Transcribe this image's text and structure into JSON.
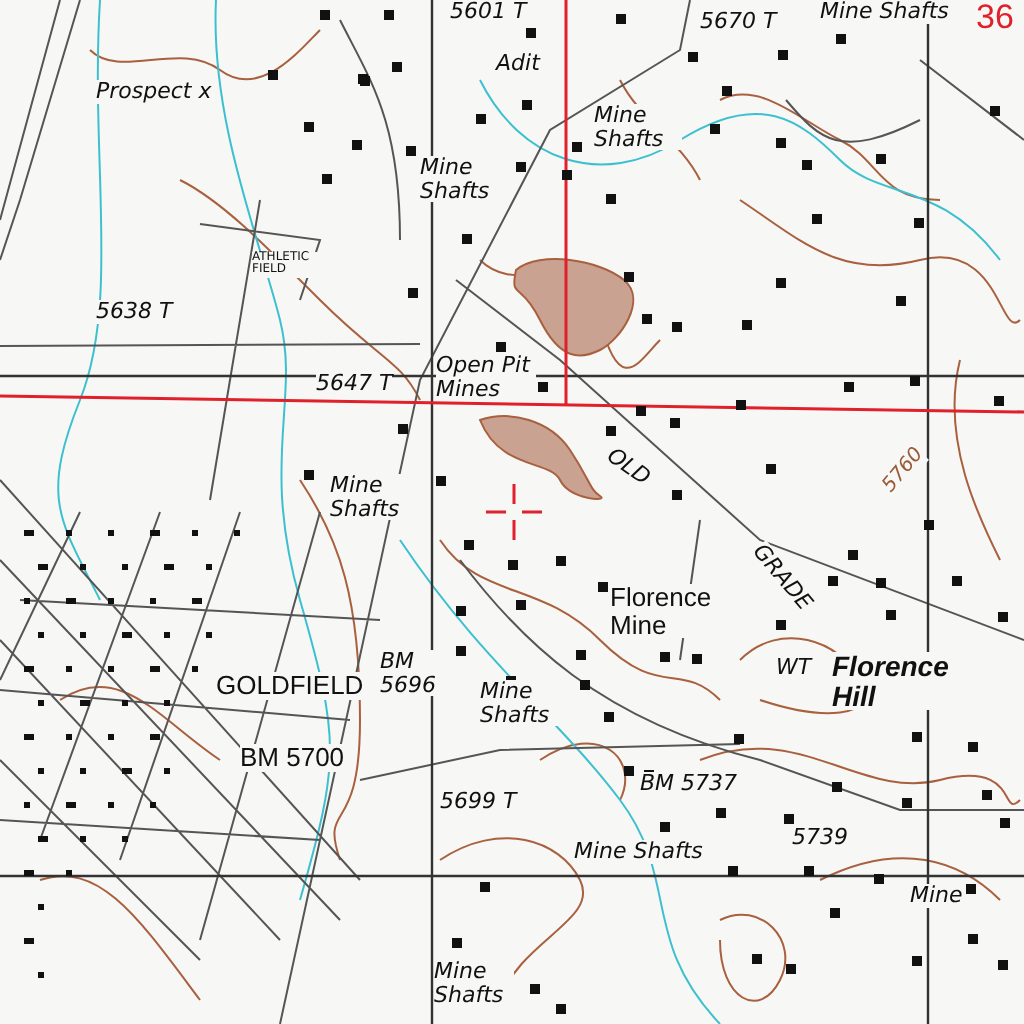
{
  "map": {
    "labels": [
      {
        "text": "5601 T",
        "kind": "elevation"
      },
      {
        "text": "5670 T",
        "kind": "elevation"
      },
      {
        "text": "Mine Shafts",
        "kind": "feature"
      },
      {
        "text": "36",
        "kind": "section"
      },
      {
        "text": "Adit",
        "kind": "feature"
      },
      {
        "text": "Prospect x",
        "kind": "feature"
      },
      {
        "text": "Mine Shafts",
        "kind": "feature"
      },
      {
        "text": "Mine Shafts",
        "kind": "feature"
      },
      {
        "text": "ATHLETIC FIELD",
        "kind": "small"
      },
      {
        "text": "5638 T",
        "kind": "elevation"
      },
      {
        "text": "5647 T",
        "kind": "elevation"
      },
      {
        "text": "Open Pit Mines",
        "kind": "feature"
      },
      {
        "text": "OLD",
        "kind": "road"
      },
      {
        "text": "Mine Shafts",
        "kind": "feature"
      },
      {
        "text": "5760",
        "kind": "contour"
      },
      {
        "text": "GRADE",
        "kind": "road"
      },
      {
        "text": "Florence Mine",
        "kind": "place"
      },
      {
        "text": "GOLDFIELD",
        "kind": "town"
      },
      {
        "text": "BM 5696",
        "kind": "elevation"
      },
      {
        "text": "Mine Shafts",
        "kind": "feature"
      },
      {
        "text": "WT",
        "kind": "feature"
      },
      {
        "text": "Florence Hill",
        "kind": "summit"
      },
      {
        "text": "BM 5700",
        "kind": "town"
      },
      {
        "text": "5699 T",
        "kind": "elevation"
      },
      {
        "text": "BM 5737",
        "kind": "elevation"
      },
      {
        "text": "5739",
        "kind": "elevation"
      },
      {
        "text": "Mine Shafts",
        "kind": "feature"
      },
      {
        "text": "Mine",
        "kind": "feature"
      },
      {
        "text": "Mine Shafts",
        "kind": "feature"
      }
    ]
  }
}
